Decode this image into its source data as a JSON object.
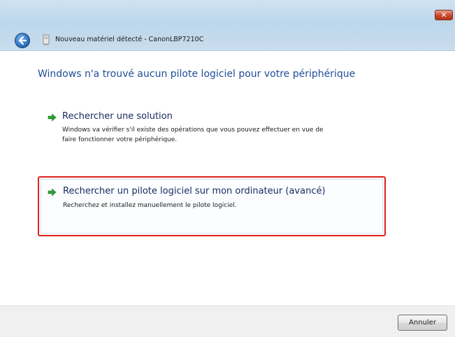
{
  "window": {
    "title": "Nouveau matériel détecté - CanonLBP7210C",
    "close_label": "✕"
  },
  "main": {
    "heading": "Windows n'a trouvé aucun pilote logiciel pour votre périphérique",
    "options": [
      {
        "title": "Rechercher une solution",
        "description_line1": "Windows va vérifier s'il existe des opérations que vous pouvez effectuer en vue de",
        "description_line2": "faire fonctionner votre périphérique.",
        "icon": "green-arrow-icon",
        "highlighted": false
      },
      {
        "title": "Rechercher un pilote logiciel sur mon ordinateur (avancé)",
        "description_line1": "Recherchez et installez manuellement le pilote logiciel.",
        "icon": "green-arrow-icon",
        "highlighted": true
      }
    ]
  },
  "footer": {
    "cancel_label": "Annuler"
  },
  "colors": {
    "heading": "#1f4e98",
    "highlight_border": "#e0201d",
    "arrow": "#2aa033"
  }
}
